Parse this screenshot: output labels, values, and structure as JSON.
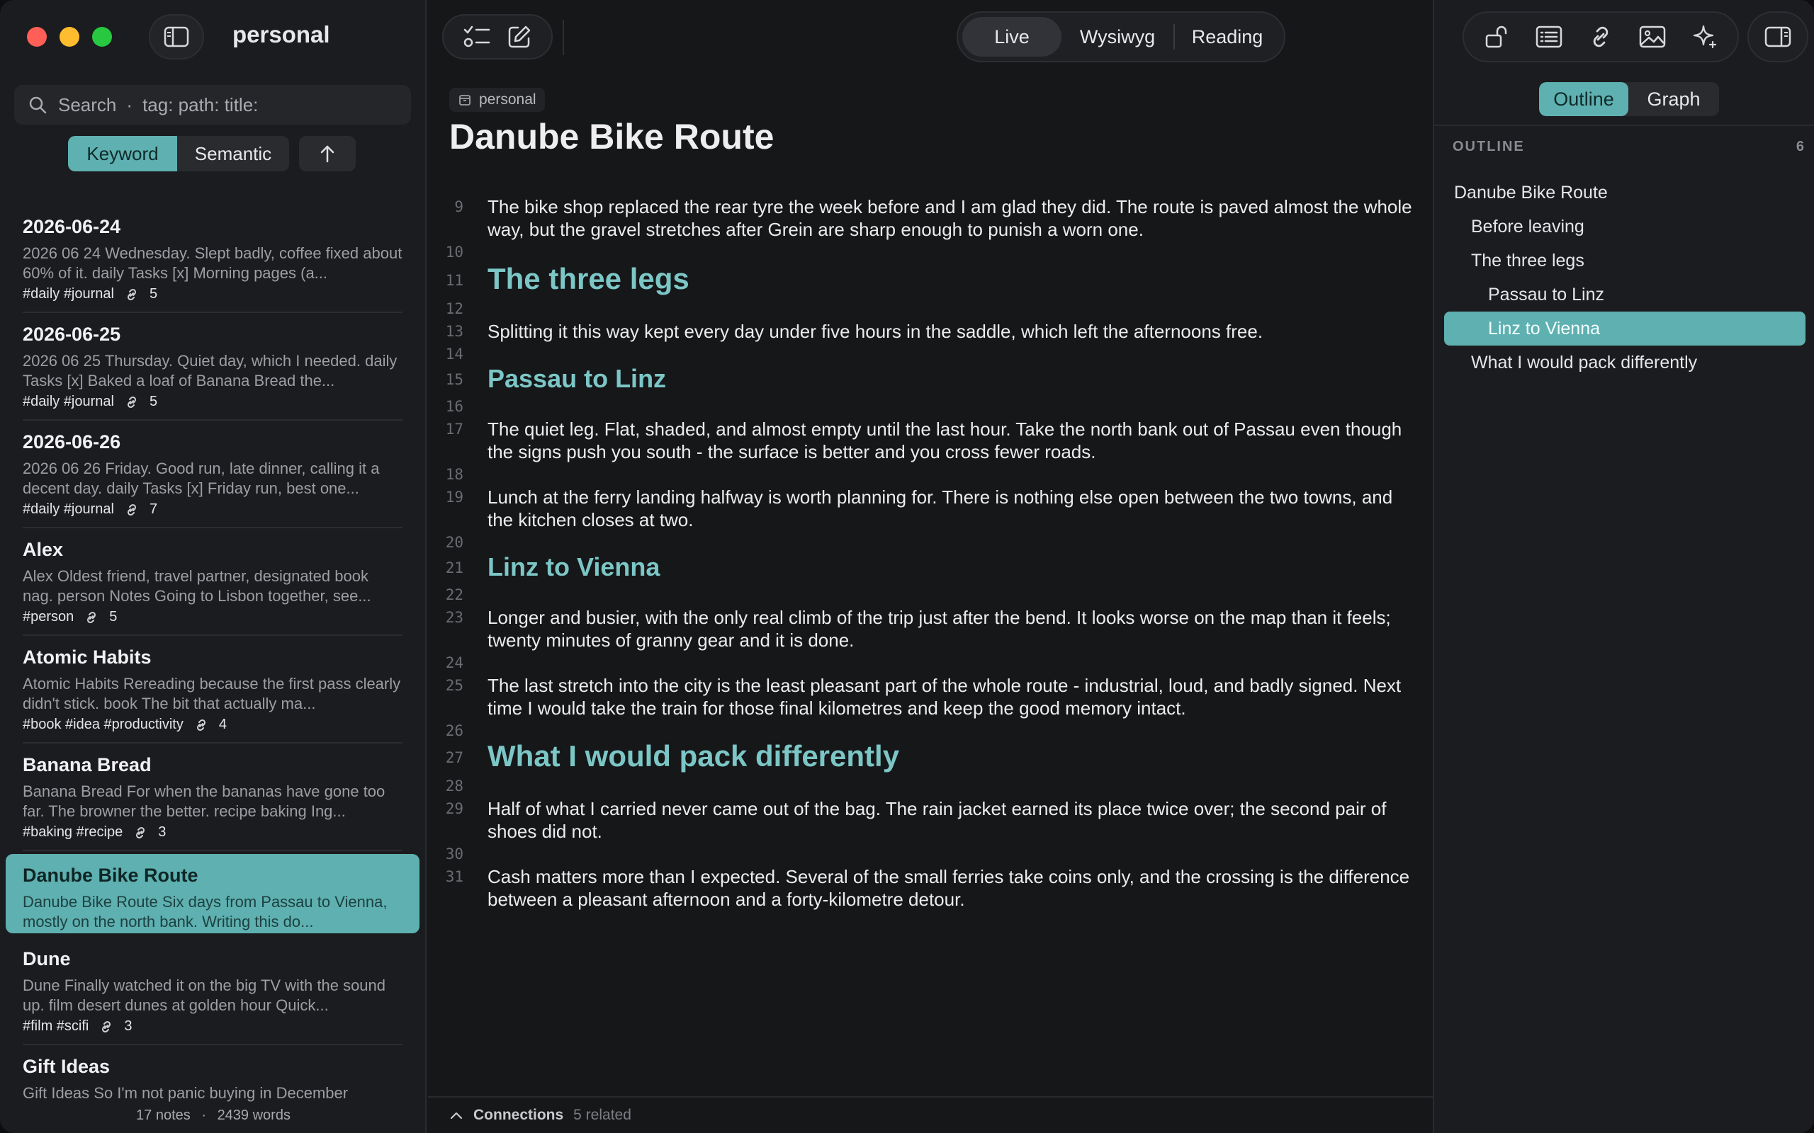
{
  "app": {
    "vault_name": "personal"
  },
  "sidebar": {
    "search_placeholder": "Search",
    "search_hint": "tag: path: title:",
    "search_modes": [
      {
        "label": "Keyword",
        "active": true
      },
      {
        "label": "Semantic",
        "active": false
      }
    ],
    "notes": [
      {
        "title": "2026-06-24",
        "snippet": "2026 06 24 Wednesday. Slept badly, coffee fixed about 60% of it. daily Tasks [x] Morning pages (a...",
        "tags": "#daily #journal",
        "links": "5"
      },
      {
        "title": "2026-06-25",
        "snippet": "2026 06 25 Thursday. Quiet day, which I needed. daily Tasks [x] Baked a loaf of Banana Bread the...",
        "tags": "#daily #journal",
        "links": "5"
      },
      {
        "title": "2026-06-26",
        "snippet": "2026 06 26 Friday. Good run, late dinner, calling it a decent day. daily Tasks [x] Friday run, best one...",
        "tags": "#daily #journal",
        "links": "7"
      },
      {
        "title": "Alex",
        "snippet": "Alex Oldest friend, travel partner, designated book nag. person Notes Going to Lisbon together, see...",
        "tags": "#person",
        "links": "5"
      },
      {
        "title": "Atomic Habits",
        "snippet": "Atomic Habits Rereading because the first pass clearly didn't stick. book The bit that actually ma...",
        "tags": "#book #idea #productivity",
        "links": "4"
      },
      {
        "title": "Banana Bread",
        "snippet": "Banana Bread For when the bananas have gone too far. The browner the better. recipe baking Ing...",
        "tags": "#baking #recipe",
        "links": "3"
      },
      {
        "title": "Danube Bike Route",
        "snippet": "Danube Bike Route Six days from Passau to Vienna, mostly on the north bank. Writing this do...",
        "tags": "",
        "links": "",
        "selected": true
      },
      {
        "title": "Dune",
        "snippet": "Dune Finally watched it on the big TV with the sound up. film desert dunes at golden hour Quick...",
        "tags": "#film #scifi",
        "links": "3"
      },
      {
        "title": "Gift Ideas",
        "snippet": "Gift Ideas So I'm not panic buying in December",
        "tags": "",
        "links": ""
      }
    ],
    "footer_notes": "17 notes",
    "footer_words": "2439 words"
  },
  "editor": {
    "modes": [
      {
        "label": "Live",
        "active": true
      },
      {
        "label": "Wysiwyg",
        "active": false
      },
      {
        "label": "Reading",
        "active": false
      }
    ],
    "breadcrumb": "personal",
    "title": "Danube Bike Route",
    "lines": [
      {
        "n": "9",
        "type": "p",
        "text": "The bike shop replaced the rear tyre the week before and I am glad they did. The route is paved almost the whole way, but the gravel stretches after Grein are sharp enough to punish a worn one."
      },
      {
        "n": "10",
        "type": "blank",
        "text": ""
      },
      {
        "n": "11",
        "type": "h2",
        "text": "The three legs"
      },
      {
        "n": "12",
        "type": "blank",
        "text": ""
      },
      {
        "n": "13",
        "type": "p",
        "text": "Splitting it this way kept every day under five hours in the saddle, which left the afternoons free."
      },
      {
        "n": "14",
        "type": "blank",
        "text": ""
      },
      {
        "n": "15",
        "type": "h3",
        "text": "Passau to Linz"
      },
      {
        "n": "16",
        "type": "blank",
        "text": ""
      },
      {
        "n": "17",
        "type": "p",
        "text": "The quiet leg. Flat, shaded, and almost empty until the last hour. Take the north bank out of Passau even though the signs push you south - the surface is better and you cross fewer roads."
      },
      {
        "n": "18",
        "type": "blank",
        "text": ""
      },
      {
        "n": "19",
        "type": "p",
        "text": "Lunch at the ferry landing halfway is worth planning for. There is nothing else open between the two towns, and the kitchen closes at two."
      },
      {
        "n": "20",
        "type": "blank",
        "text": ""
      },
      {
        "n": "21",
        "type": "h3",
        "text": "Linz to Vienna"
      },
      {
        "n": "22",
        "type": "blank",
        "text": ""
      },
      {
        "n": "23",
        "type": "p",
        "text": "Longer and busier, with the only real climb of the trip just after the bend. It looks worse on the map than it feels; twenty minutes of granny gear and it is done."
      },
      {
        "n": "24",
        "type": "blank",
        "text": ""
      },
      {
        "n": "25",
        "type": "p",
        "text": "The last stretch into the city is the least pleasant part of the whole route - industrial, loud, and badly signed. Next time I would take the train for those final kilometres and keep the good memory intact."
      },
      {
        "n": "26",
        "type": "blank",
        "text": ""
      },
      {
        "n": "27",
        "type": "h2",
        "text": "What I would pack differently"
      },
      {
        "n": "28",
        "type": "blank",
        "text": ""
      },
      {
        "n": "29",
        "type": "p",
        "text": "Half of what I carried never came out of the bag. The rain jacket earned its place twice over; the second pair of shoes did not."
      },
      {
        "n": "30",
        "type": "blank",
        "text": ""
      },
      {
        "n": "31",
        "type": "p",
        "text": "Cash matters more than I expected. Several of the small ferries take coins only, and the crossing is the difference between a pleasant afternoon and a forty-kilometre detour."
      }
    ],
    "connections_label": "Connections",
    "connections_count": "5 related"
  },
  "right_panel": {
    "tabs": [
      {
        "label": "Outline",
        "active": true
      },
      {
        "label": "Graph",
        "active": false
      }
    ],
    "outline_heading": "OUTLINE",
    "outline_count": "6",
    "outline": [
      {
        "label": "Danube Bike Route",
        "level": 1
      },
      {
        "label": "Before leaving",
        "level": 2
      },
      {
        "label": "The three legs",
        "level": 2
      },
      {
        "label": "Passau to Linz",
        "level": 3
      },
      {
        "label": "Linz to Vienna",
        "level": 3,
        "active": true
      },
      {
        "label": "What I would pack differently",
        "level": 2
      }
    ]
  },
  "colors": {
    "accent": "#5fb0b0",
    "heading": "#7cc6c6",
    "background": "#161719",
    "sidebar": "#1b1c1f"
  }
}
